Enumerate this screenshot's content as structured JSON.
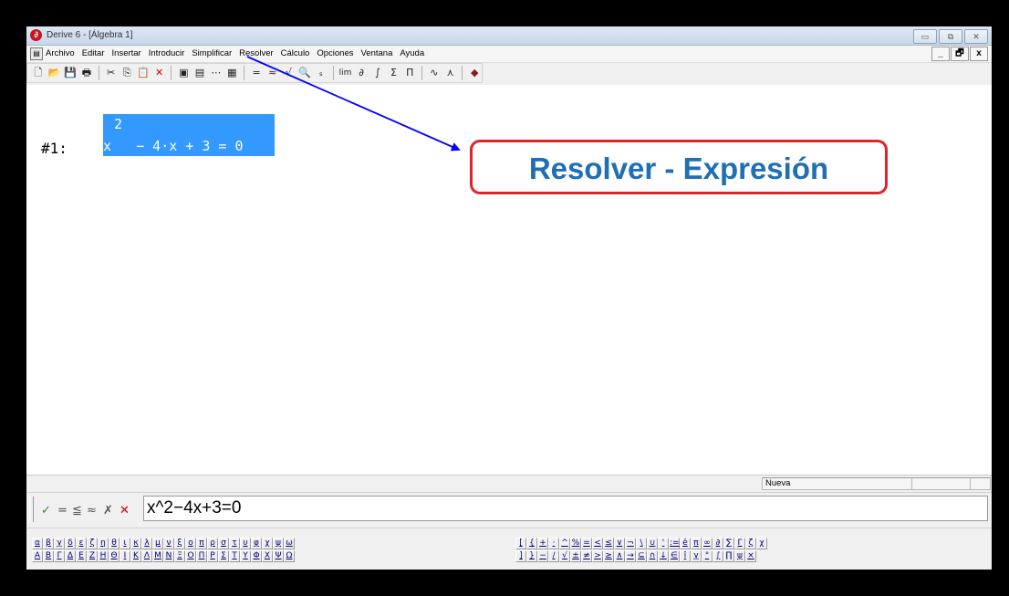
{
  "window": {
    "title": "Derive 6 - [Álgebra 1]",
    "app_icon": "derive-app-icon",
    "controls": [
      "▭",
      "⧉",
      "✕"
    ]
  },
  "menubar": {
    "items": [
      "Archivo",
      "Editar",
      "Insertar",
      "Introducir",
      "Simplificar",
      "Resolver",
      "Cálculo",
      "Opciones",
      "Ventana",
      "Ayuda"
    ],
    "mdi_controls": [
      "_",
      "🗗",
      "x"
    ]
  },
  "toolbar": {
    "buttons": [
      "new-file-icon",
      "open-file-icon",
      "save-icon",
      "print-icon",
      "cut-icon",
      "copy-icon",
      "paste-icon",
      "delete-icon",
      "insert-text-icon",
      "insert-object-icon",
      "vector-icon",
      "matrix-icon",
      "simplify-icon",
      "approximate-icon",
      "solve-icon",
      "substitute-icon",
      "sum-subscript-icon",
      "limit-icon",
      "derivative-icon",
      "integral-icon",
      "sum-icon",
      "product-icon",
      "plot-2d-icon",
      "plot-3d-icon",
      "help-book-icon"
    ]
  },
  "expression": {
    "label": "#1:",
    "exponent": "2",
    "text": "x   − 4·x + 3 = 0"
  },
  "annotation": {
    "callout_text": "Resolver - Expresión",
    "callout_border_color": "#e0242c",
    "callout_text_color": "#1f6fb5",
    "arrow_color": "#0000ff"
  },
  "statusbar": {
    "mode": "Nueva"
  },
  "entry": {
    "buttons": [
      "✓",
      "=",
      "≦",
      "≈",
      "✗",
      "✕"
    ],
    "value": "x^2−4x+3=0"
  },
  "greek_lower": [
    "α",
    "β",
    "γ",
    "δ",
    "ε",
    "ζ",
    "η",
    "θ",
    "ι",
    "κ",
    "λ",
    "μ",
    "ν",
    "ξ",
    "ο",
    "π",
    "ρ",
    "σ",
    "τ",
    "υ",
    "φ",
    "χ",
    "ψ",
    "ω"
  ],
  "greek_upper": [
    "Α",
    "Β",
    "Γ",
    "Δ",
    "Ε",
    "Ζ",
    "Η",
    "Θ",
    "Ι",
    "Κ",
    "Λ",
    "Μ",
    "Ν",
    "Ξ",
    "Ο",
    "Π",
    "Ρ",
    "Σ",
    "Τ",
    "Υ",
    "Φ",
    "Χ",
    "Ψ",
    "Ω"
  ],
  "math_row1": [
    "[",
    "{",
    "+",
    "·",
    "^",
    "%",
    "=",
    "<",
    "≤",
    "∨",
    "¬",
    "\\",
    "∪",
    "'",
    ":=",
    "ê",
    "π",
    "∞",
    "∂",
    "∑",
    "Γ",
    "ζ",
    "χ"
  ],
  "math_row2": [
    "]",
    "}",
    "−",
    "/",
    "√",
    "±",
    "≠",
    ">",
    "≥",
    "∧",
    "→",
    "⊆",
    "∩",
    "↓",
    "∈",
    "î",
    "γ",
    "°",
    "∫",
    "∏",
    "ψ",
    "×"
  ],
  "colors": {
    "selection": "#3399ff",
    "workspace": "#ffffff",
    "chrome": "#f0f0f0"
  }
}
